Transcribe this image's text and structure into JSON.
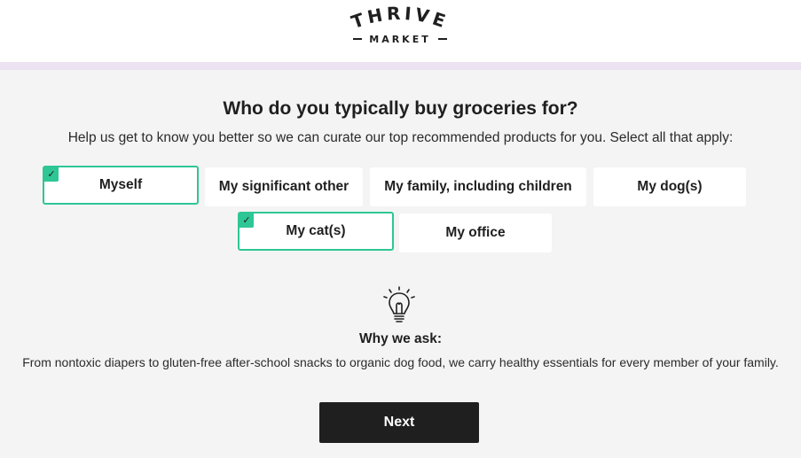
{
  "header": {
    "logo_top": "THRIVE",
    "logo_bottom": "MARKET"
  },
  "question": {
    "title": "Who do you typically buy groceries for?",
    "subtitle": "Help us get to know you better so we can curate our top recommended products for you. Select all that apply:"
  },
  "options": [
    {
      "label": "Myself",
      "selected": true
    },
    {
      "label": "My significant other",
      "selected": false
    },
    {
      "label": "My family, including children",
      "selected": false
    },
    {
      "label": "My dog(s)",
      "selected": false
    },
    {
      "label": "My cat(s)",
      "selected": true
    },
    {
      "label": "My office",
      "selected": false
    }
  ],
  "info": {
    "icon": "lightbulb-icon",
    "title": "Why we ask:",
    "text": "From nontoxic diapers to gluten-free after-school snacks to organic dog food, we carry healthy essentials for every member of your family."
  },
  "next_label": "Next",
  "colors": {
    "accent": "#2ec695",
    "background": "#f4f4f4",
    "stripe": "#ece3f2",
    "button": "#1f1f1f"
  }
}
